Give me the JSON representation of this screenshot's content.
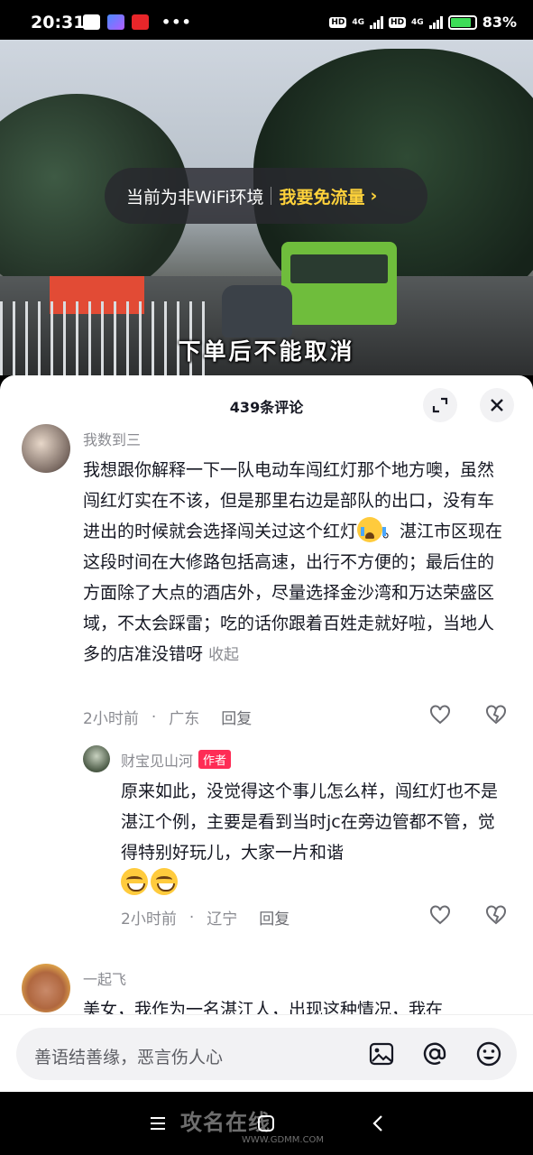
{
  "status_bar": {
    "time": "20:31",
    "network_1": "4G",
    "network_2": "4G",
    "hd_label": "HD",
    "battery_percent": "83%"
  },
  "video": {
    "wifi_notice": "当前为非WiFi环境",
    "wifi_cta": "我要免流量",
    "subtitle": "下单后不能取消"
  },
  "comments_panel": {
    "title": "439条评论"
  },
  "comments": [
    {
      "user": "我数到三",
      "text_before_emoji": "我想跟你解释一下一队电动车闯红灯那个地方噢，虽然闯红灯实在不该，但是那里右边是部队的出口，没有车进出的时候就会选择闯关过这个红灯",
      "text_after_emoji": "。湛江市区现在这段时间在大修路包括高速，出行不方便的；最后住的方面除了大点的酒店外，尽量选择金沙湾和万达荣盛区域，不太会踩雷；吃的话你跟着百姓走就好啦，当地人多的店准没错呀",
      "collapse_label": "收起",
      "time": "2小时前",
      "location": "广东",
      "reply_label": "回复"
    },
    {
      "user": "财宝见山河",
      "author_tag": "作者",
      "text": "原来如此，没觉得这个事儿怎么样，闯红灯也不是湛江个例，主要是看到当时jc在旁边管都不管，觉得特别好玩儿，大家一片和谐",
      "time": "2小时前",
      "location": "辽宁",
      "reply_label": "回复"
    },
    {
      "user": "一起飞",
      "text": "美女，我作为一名湛江人，出现这种情况，我在"
    }
  ],
  "input_bar": {
    "placeholder": "善语结善缘，恶言伤人心"
  },
  "watermark": {
    "text": "攻名在线",
    "url": "WWW.GDMM.COM"
  },
  "colors": {
    "accent_cta": "#ffd23b",
    "author_tag": "#fe2c55",
    "muted_text": "#8a8b91"
  }
}
